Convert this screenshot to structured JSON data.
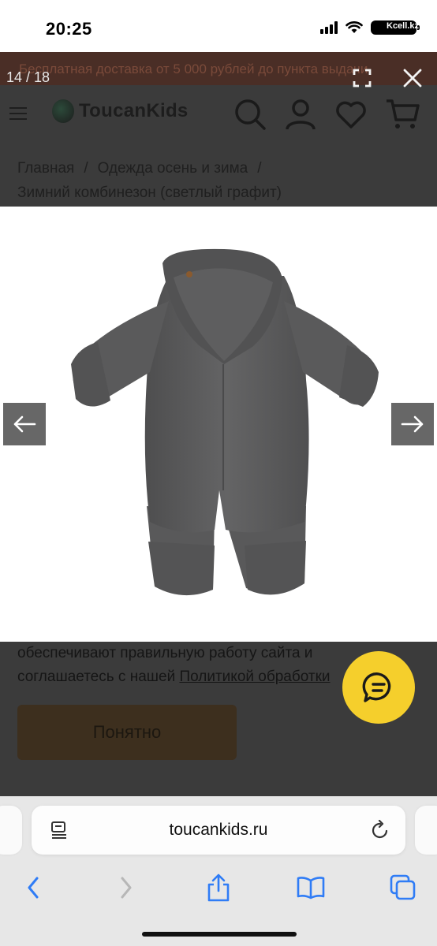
{
  "status": {
    "time": "20:25",
    "carrier": "Kcell.kz"
  },
  "site": {
    "promo": "Бесплатная доставка от 5 000 рублей до пункта выдачи",
    "logo": "ToucanKids",
    "breadcrumbs": {
      "home": "Главная",
      "category": "Одежда осень и зима",
      "current": "Зимний комбинезон (светлый графит)"
    },
    "cookie": {
      "text": "обеспечивают правильную работу сайта и соглашаетесь с нашей",
      "link": "Политикой обработки",
      "button": "Понятно"
    }
  },
  "gallery": {
    "counter": "14 / 18",
    "current_index": 14,
    "total": 18
  },
  "browser": {
    "url": "toucankids.ru"
  },
  "colors": {
    "chat": "#f5cf2c",
    "accent_blue": "#2f7cf6",
    "garment": "#5d5d5e"
  }
}
